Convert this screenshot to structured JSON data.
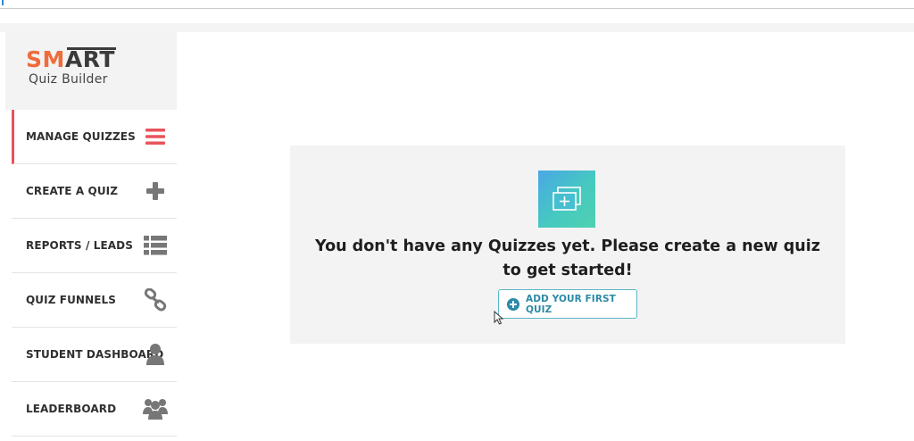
{
  "logo": {
    "word_part1": "SM",
    "word_part2": "ART",
    "subtitle": "Quiz Builder"
  },
  "sidebar": {
    "items": [
      {
        "label": "MANAGE QUIZZES",
        "icon": "hamburger-icon",
        "active": true
      },
      {
        "label": "CREATE A QUIZ",
        "icon": "plus-icon",
        "active": false
      },
      {
        "label": "REPORTS / LEADS",
        "icon": "list-icon",
        "active": false
      },
      {
        "label": "QUIZ FUNNELS",
        "icon": "link-icon",
        "active": false
      },
      {
        "label": "STUDENT DASHBOARD",
        "icon": "user-icon",
        "active": false
      },
      {
        "label": "LEADERBOARD",
        "icon": "users-icon",
        "active": false
      }
    ]
  },
  "main": {
    "empty_state_icon": "add-quiz-icon",
    "empty_message": "You don't have any Quizzes yet. Please create a new quiz to get started!",
    "add_button_label": "ADD YOUR FIRST QUIZ",
    "add_button_icon": "plus-circle-icon"
  },
  "colors": {
    "brand_orange": "#ee6d3a",
    "active_accent": "#e8545a",
    "button_text": "#2b8aa6",
    "tile_gradient_start": "#4aa7e6",
    "tile_gradient_end": "#4fd1b0"
  }
}
